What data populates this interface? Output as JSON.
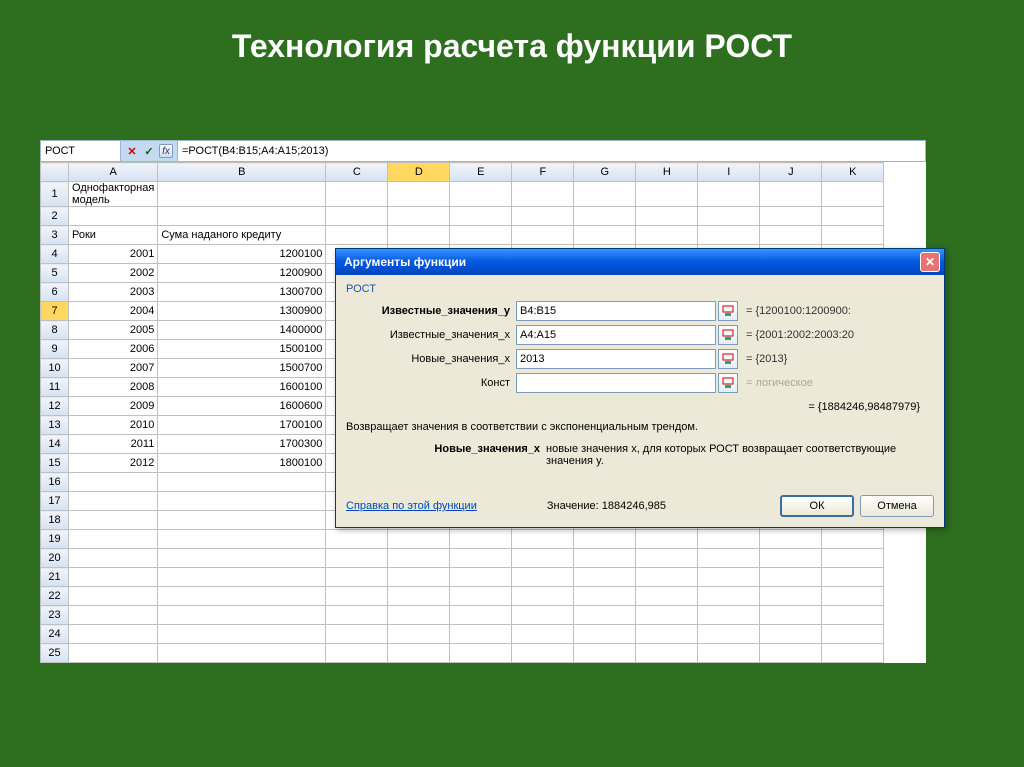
{
  "slide": {
    "title": "Технология расчета функции РОСТ"
  },
  "formula": {
    "name": "РОСТ",
    "content": "=РОСТ(B4:B15;A4:A15;2013)"
  },
  "columns": [
    "A",
    "B",
    "C",
    "D",
    "E",
    "F",
    "G",
    "H",
    "I",
    "J",
    "K"
  ],
  "cells": {
    "A1": "Однофакторная модель",
    "A3": "Роки",
    "B3": "Сума наданого кредиту",
    "A4": "2001",
    "B4": "1200100",
    "A5": "2002",
    "B5": "1200900",
    "A6": "2003",
    "B6": "1300700",
    "A7": "2004",
    "B7": "1300900",
    "A8": "2005",
    "B8": "1400000",
    "A9": "2006",
    "B9": "1500100",
    "A10": "2007",
    "B10": "1500700",
    "A11": "2008",
    "B11": "1600100",
    "A12": "2009",
    "B12": "1600600",
    "A13": "2010",
    "B13": "1700100",
    "A14": "2011",
    "B14": "1700300",
    "A15": "2012",
    "B15": "1800100"
  },
  "dialog": {
    "title": "Аргументы функции",
    "func": "РОСТ",
    "args": [
      {
        "label": "Известные_значения_y",
        "value": "B4:B15",
        "result": "= {1200100:1200900:",
        "bold": true
      },
      {
        "label": "Известные_значения_x",
        "value": "A4:A15",
        "result": "= {2001:2002:2003:20",
        "bold": false
      },
      {
        "label": "Новые_значения_x",
        "value": "2013",
        "result": "= {2013}",
        "bold": false
      },
      {
        "label": "Конст",
        "value": "",
        "result": "= логическое",
        "bold": false,
        "grey": true
      }
    ],
    "formula_result": "= {1884246,98487979}",
    "description": "Возвращает значения в соответствии с экспоненциальным трендом.",
    "arg_help_label": "Новые_значения_x",
    "arg_help_text": "новые значения x, для которых РОСТ возвращает соответствующие значения y.",
    "help_link": "Справка по этой функции",
    "value_label": "Значение:",
    "value": "1884246,985",
    "ok": "ОК",
    "cancel": "Отмена"
  }
}
